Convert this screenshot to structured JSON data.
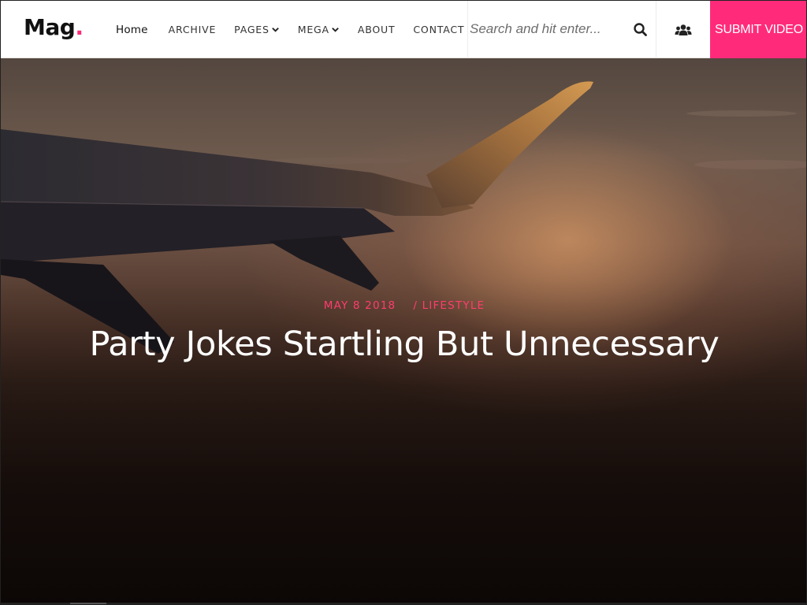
{
  "brand": {
    "logo_text": "Mag",
    "logo_dot": ".",
    "accent_color": "#ff2b7a"
  },
  "nav": {
    "items": [
      {
        "label": "Home",
        "dropdown": false,
        "active": true
      },
      {
        "label": "ARCHIVE",
        "dropdown": false
      },
      {
        "label": "PAGES",
        "dropdown": true
      },
      {
        "label": "MEGA",
        "dropdown": true
      },
      {
        "label": "ABOUT",
        "dropdown": false
      },
      {
        "label": "CONTACT",
        "dropdown": false
      }
    ]
  },
  "search": {
    "placeholder": "Search and hit enter...",
    "icon": "search-icon"
  },
  "users_icon": "users-icon",
  "submit_button": {
    "label": "SUBMIT VIDEO"
  },
  "hero": {
    "date": "MAY 8 2018",
    "category": "/ LIFESTYLE",
    "title": "Party Jokes Startling But Unnecessary",
    "meta_color": "#ff3d6e"
  }
}
